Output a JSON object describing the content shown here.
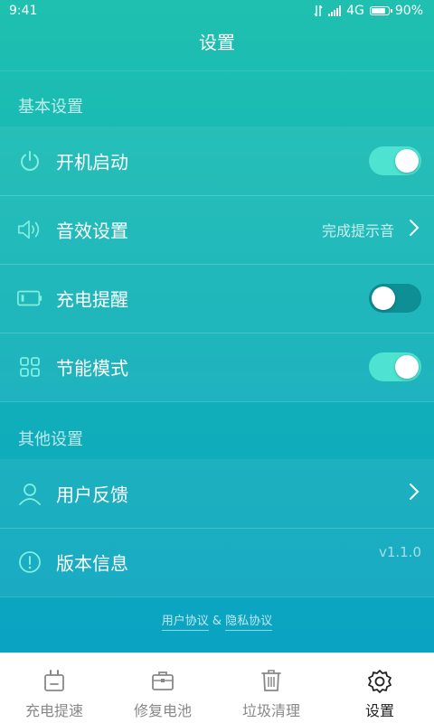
{
  "status": {
    "time": "9:41",
    "network": "4G",
    "battery": "90%"
  },
  "header": {
    "title": "设置"
  },
  "sections": {
    "basic": "基本设置",
    "other": "其他设置"
  },
  "rows": {
    "startup": {
      "label": "开机启动",
      "toggle": "on"
    },
    "sound": {
      "label": "音效设置",
      "value": "完成提示音"
    },
    "charge_remind": {
      "label": "充电提醒",
      "toggle": "off"
    },
    "power_save": {
      "label": "节能模式",
      "toggle": "on"
    },
    "feedback": {
      "label": "用户反馈"
    },
    "version": {
      "label": "版本信息",
      "value": "v1.1.0"
    }
  },
  "links": {
    "agreement": "用户协议",
    "separator": "&",
    "privacy": "隐私协议"
  },
  "tabs": [
    {
      "label": "充电提速",
      "icon": "charger-icon"
    },
    {
      "label": "修复电池",
      "icon": "toolbox-icon"
    },
    {
      "label": "垃圾清理",
      "icon": "trash-icon"
    },
    {
      "label": "设置",
      "icon": "gear-icon"
    }
  ],
  "colors": {
    "accent": "#1fc0b0",
    "toggle_on": "#4ee3d0",
    "toggle_off": "#0d8f95"
  }
}
